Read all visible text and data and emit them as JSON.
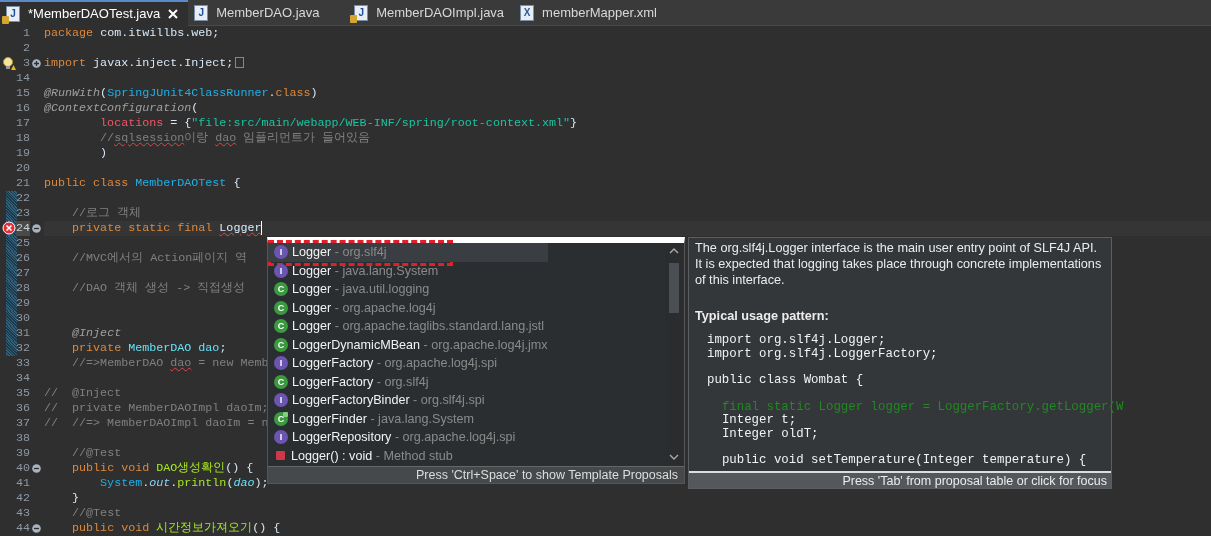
{
  "tabs": [
    {
      "label": "*MemberDAOTest.java",
      "icon_letter": "J",
      "kind": "java",
      "badge": true,
      "selected": true,
      "closable": true
    },
    {
      "label": "MemberDAO.java",
      "icon_letter": "J",
      "kind": "java",
      "badge": false,
      "selected": false,
      "closable": false
    },
    {
      "label": "MemberDAOImpl.java",
      "icon_letter": "J",
      "kind": "java",
      "badge": true,
      "selected": false,
      "closable": false
    },
    {
      "label": "memberMapper.xml",
      "icon_letter": "X",
      "kind": "xml",
      "badge": false,
      "selected": false,
      "closable": false
    }
  ],
  "editor": {
    "lines": [
      {
        "n": "1",
        "current": false,
        "changed": false,
        "tokens": [
          {
            "text": "package",
            "kind": "kw"
          },
          {
            "text": " com.itwillbs.web;",
            "kind": "plain"
          }
        ]
      },
      {
        "n": "2",
        "current": false,
        "changed": false
      },
      {
        "n": "3",
        "current": false,
        "changed": false,
        "marker": {
          "kind": "warning"
        },
        "fold": {
          "kind": "plus"
        },
        "folded": true,
        "tokens": [
          {
            "text": "import",
            "kind": "kw"
          },
          {
            "text": " javax.inject.Inject;",
            "kind": "plain"
          }
        ]
      },
      {
        "n": "14",
        "current": false,
        "changed": false
      },
      {
        "n": "15",
        "current": false,
        "changed": false,
        "tokens": [
          {
            "text": "@RunWith",
            "kind": "ann"
          },
          {
            "text": "(",
            "kind": "plain"
          },
          {
            "text": "SpringJUnit4ClassRunner",
            "kind": "type"
          },
          {
            "text": ".",
            "kind": "plain"
          },
          {
            "text": "class",
            "kind": "kw"
          },
          {
            "text": ")",
            "kind": "plain"
          }
        ]
      },
      {
        "n": "16",
        "current": false,
        "changed": false,
        "tokens": [
          {
            "text": "@ContextConfiguration",
            "kind": "ann"
          },
          {
            "text": "(",
            "kind": "plain"
          }
        ]
      },
      {
        "n": "17",
        "current": false,
        "changed": false,
        "tokens": [
          {
            "text": "        locations",
            "kind": "attr"
          },
          {
            "text": " = {",
            "kind": "plain"
          },
          {
            "text": "\"file:src/main/webapp/WEB-INF/spring/root-context.xml\"",
            "kind": "str"
          },
          {
            "text": "}",
            "kind": "plain"
          }
        ]
      },
      {
        "n": "18",
        "current": false,
        "changed": false,
        "tokens": [
          {
            "text": "        //",
            "kind": "comment"
          },
          {
            "text": "sqlsession",
            "kind": "comment",
            "squiggle": true
          },
          {
            "text": "이랑 ",
            "kind": "comment"
          },
          {
            "text": "dao",
            "kind": "comment",
            "squiggle": true
          },
          {
            "text": " 임플리먼트가 들어있음",
            "kind": "comment"
          }
        ]
      },
      {
        "n": "19",
        "current": false,
        "changed": false,
        "tokens": [
          {
            "text": "        )",
            "kind": "plain"
          }
        ]
      },
      {
        "n": "20",
        "current": false,
        "changed": false
      },
      {
        "n": "21",
        "current": false,
        "changed": false,
        "tokens": [
          {
            "text": "public class",
            "kind": "kw"
          },
          {
            "text": " MemberDAOTest",
            "kind": "type"
          },
          {
            "text": " {",
            "kind": "plain"
          }
        ]
      },
      {
        "n": "22",
        "current": false,
        "changed": true
      },
      {
        "n": "23",
        "current": false,
        "changed": true,
        "tokens": [
          {
            "text": "    //로그 객체",
            "kind": "comment"
          }
        ]
      },
      {
        "n": "24",
        "current": true,
        "changed": true,
        "marker": {
          "kind": "error"
        },
        "fold": {
          "kind": "minus"
        },
        "tokens": [
          {
            "text": "    private static final",
            "kind": "kw"
          },
          {
            "text": " Logger",
            "kind": "plain",
            "squiggle": true
          }
        ]
      },
      {
        "n": "25",
        "current": false,
        "changed": true
      },
      {
        "n": "26",
        "current": false,
        "changed": true,
        "tokens": [
          {
            "text": "    //MVC에서의 Action페이지 역",
            "kind": "comment"
          }
        ]
      },
      {
        "n": "27",
        "current": false,
        "changed": true
      },
      {
        "n": "28",
        "current": false,
        "changed": true,
        "tokens": [
          {
            "text": "    //DAO 객체 생성 -> 직접생성",
            "kind": "comment"
          }
        ]
      },
      {
        "n": "29",
        "current": false,
        "changed": true
      },
      {
        "n": "30",
        "current": false,
        "changed": true
      },
      {
        "n": "31",
        "current": false,
        "changed": true,
        "tokens": [
          {
            "text": "    @Inject",
            "kind": "ann"
          }
        ]
      },
      {
        "n": "32",
        "current": false,
        "changed": true,
        "tokens": [
          {
            "text": "    private",
            "kind": "kw"
          },
          {
            "text": " MemberDAO",
            "kind": "typeref"
          },
          {
            "text": " dao",
            "kind": "field"
          },
          {
            "text": ";",
            "kind": "plain"
          }
        ]
      },
      {
        "n": "33",
        "current": false,
        "changed": false,
        "tokens": [
          {
            "text": "    //=>MemberDAO ",
            "kind": "comment"
          },
          {
            "text": "dao",
            "kind": "comment",
            "squiggle": true
          },
          {
            "text": " = new Memb",
            "kind": "comment"
          }
        ]
      },
      {
        "n": "34",
        "current": false,
        "changed": false
      },
      {
        "n": "35",
        "current": false,
        "changed": false,
        "tokens": [
          {
            "text": "//  @Inject",
            "kind": "comment"
          }
        ]
      },
      {
        "n": "36",
        "current": false,
        "changed": false,
        "tokens": [
          {
            "text": "//  private MemberDAOImpl daoIm;",
            "kind": "comment"
          }
        ]
      },
      {
        "n": "37",
        "current": false,
        "changed": false,
        "tokens": [
          {
            "text": "//  //=> MemberDAOImpl daoIm = n",
            "kind": "comment"
          }
        ]
      },
      {
        "n": "38",
        "current": false,
        "changed": false
      },
      {
        "n": "39",
        "current": false,
        "changed": false,
        "tokens": [
          {
            "text": "    //@Test",
            "kind": "comment"
          }
        ]
      },
      {
        "n": "40",
        "current": false,
        "changed": false,
        "fold": {
          "kind": "minus"
        },
        "tokens": [
          {
            "text": "    public void",
            "kind": "kw"
          },
          {
            "text": " DAO생성확인",
            "kind": "method"
          },
          {
            "text": "() {",
            "kind": "plain"
          }
        ]
      },
      {
        "n": "41",
        "current": false,
        "changed": false,
        "tokens": [
          {
            "text": "        System",
            "kind": "type"
          },
          {
            "text": ".",
            "kind": "plain"
          },
          {
            "text": "out",
            "kind": "static"
          },
          {
            "text": ".",
            "kind": "plain"
          },
          {
            "text": "println",
            "kind": "method"
          },
          {
            "text": "(",
            "kind": "plain"
          },
          {
            "text": "dao",
            "kind": "fieldref"
          },
          {
            "text": ");",
            "kind": "plain"
          }
        ]
      },
      {
        "n": "42",
        "current": false,
        "changed": false,
        "tokens": [
          {
            "text": "    }",
            "kind": "plain"
          }
        ]
      },
      {
        "n": "43",
        "current": false,
        "changed": false,
        "tokens": [
          {
            "text": "    //@Test",
            "kind": "comment"
          }
        ]
      },
      {
        "n": "44",
        "current": false,
        "changed": false,
        "fold": {
          "kind": "minus"
        },
        "tokens": [
          {
            "text": "    public void",
            "kind": "kw"
          },
          {
            "text": " 시간정보가져오기",
            "kind": "method"
          },
          {
            "text": "() {",
            "kind": "plain"
          }
        ]
      }
    ]
  },
  "completion": {
    "items": [
      {
        "kind": "interface",
        "icon_letter": "I",
        "name": "Logger",
        "qualifier": "org.slf4j",
        "selected": true,
        "callout": true
      },
      {
        "kind": "interface",
        "icon_letter": "I",
        "name": "Logger",
        "qualifier": "java.lang.System",
        "selected": false,
        "callout": false
      },
      {
        "kind": "class",
        "icon_letter": "C",
        "name": "Logger",
        "qualifier": "java.util.logging",
        "selected": false,
        "callout": false
      },
      {
        "kind": "class",
        "icon_letter": "C",
        "name": "Logger",
        "qualifier": "org.apache.log4j",
        "selected": false,
        "callout": false
      },
      {
        "kind": "class",
        "icon_letter": "C",
        "name": "Logger",
        "qualifier": "org.apache.taglibs.standard.lang.jstl",
        "selected": false,
        "callout": false
      },
      {
        "kind": "class",
        "icon_letter": "C",
        "name": "LoggerDynamicMBean",
        "qualifier": "org.apache.log4j.jmx",
        "selected": false,
        "callout": false
      },
      {
        "kind": "interface",
        "icon_letter": "I",
        "name": "LoggerFactory",
        "qualifier": "org.apache.log4j.spi",
        "selected": false,
        "callout": false
      },
      {
        "kind": "class",
        "icon_letter": "C",
        "name": "LoggerFactory",
        "qualifier": "org.slf4j",
        "selected": false,
        "callout": false
      },
      {
        "kind": "interface",
        "icon_letter": "I",
        "name": "LoggerFactoryBinder",
        "qualifier": "org.slf4j.spi",
        "selected": false,
        "callout": false
      },
      {
        "kind": "abstract_class",
        "icon_letter": "C",
        "name": "LoggerFinder",
        "qualifier": "java.lang.System",
        "selected": false,
        "callout": false
      },
      {
        "kind": "interface",
        "icon_letter": "I",
        "name": "LoggerRepository",
        "qualifier": "org.apache.log4j.spi",
        "selected": false,
        "callout": false
      },
      {
        "kind": "method",
        "name": "Logger() : void",
        "qualifier": "Method stub",
        "selected": false,
        "callout": false
      }
    ],
    "separator": "-",
    "footer": "Press 'Ctrl+Space' to show Template Proposals"
  },
  "documentation": {
    "paragraph": "The org.slf4j.Logger interface is the main user entry point of SLF4J API. It is expected that logging takes place through concrete implementations of this interface.",
    "heading": "Typical usage pattern:",
    "code_blocks": [
      [
        {
          "text": "import org.slf4j.Logger;",
          "kind": "code"
        },
        {
          "text": "import org.slf4j.LoggerFactory;",
          "kind": "code"
        }
      ],
      [
        {
          "text": "public class Wombat {",
          "kind": "code"
        }
      ],
      [
        {
          "text": "  final static Logger logger = LoggerFactory.getLogger(W",
          "kind": "highlight"
        },
        {
          "text": "  Integer t;",
          "kind": "code"
        },
        {
          "text": "  Integer oldT;",
          "kind": "code"
        }
      ],
      [
        {
          "text": "  public void setTemperature(Integer temperature) {",
          "kind": "code"
        }
      ]
    ],
    "footer": "Press 'Tab' from proposal table or click for focus"
  }
}
